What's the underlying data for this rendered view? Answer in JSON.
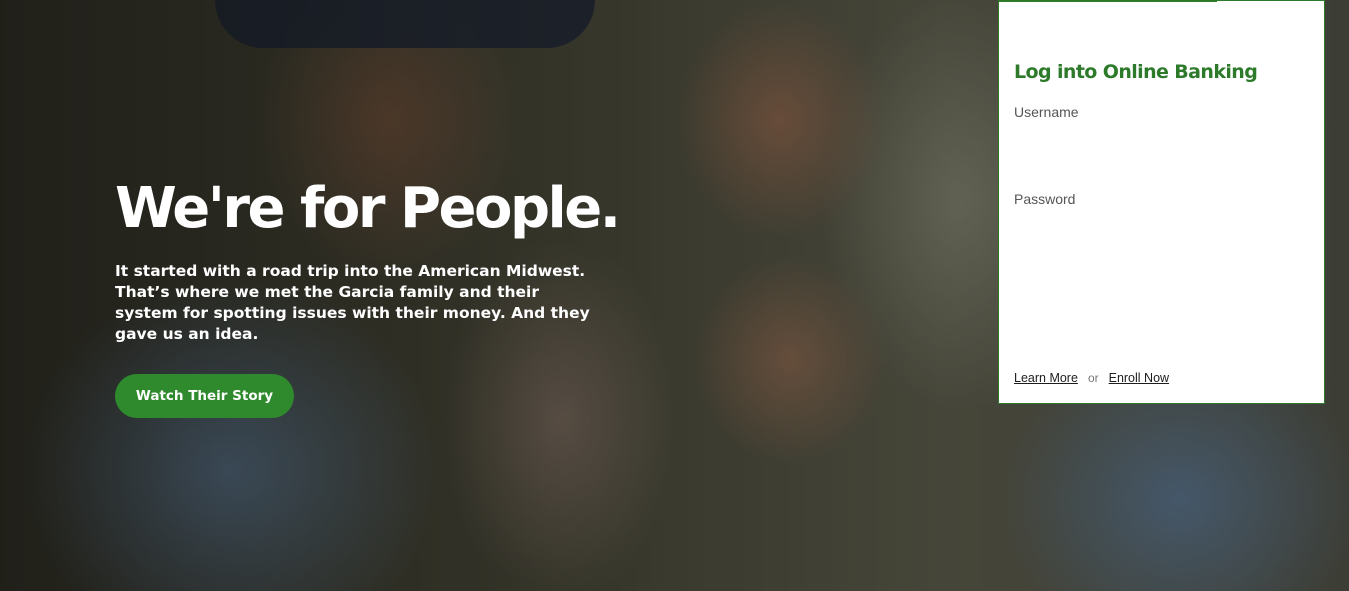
{
  "hero": {
    "headline": "We're for People.",
    "intro": "It started with a road trip into the American Midwest. That’s where we met the Garcia family and their system for spotting issues with their money. And they gave us an idea.",
    "cta_label": "Watch Their Story"
  },
  "login": {
    "title": "Log into Online Banking",
    "username_label": "Username",
    "username_value": "",
    "password_label": "Password",
    "password_value": "",
    "learn_more_label": "Learn More",
    "or_label": "or",
    "enroll_label": "Enroll Now"
  },
  "colors": {
    "brand_green": "#2d7a2b",
    "button_green": "#2f8a2d",
    "text_white": "#ffffff"
  }
}
